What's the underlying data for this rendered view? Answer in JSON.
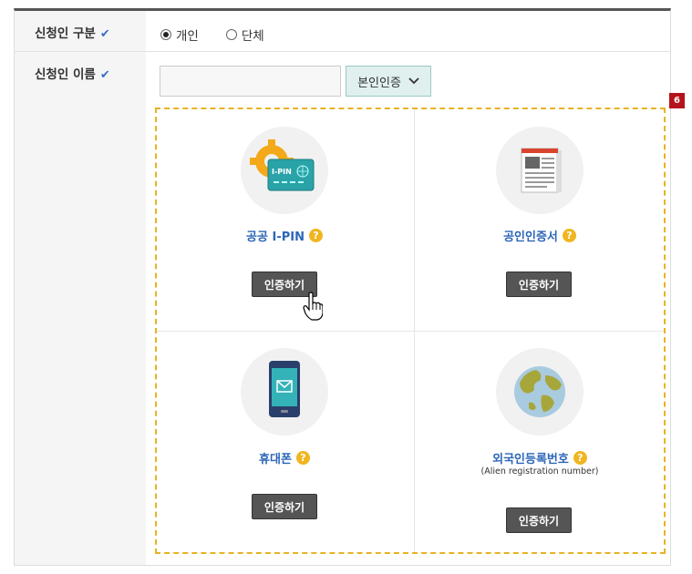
{
  "form": {
    "row1_label": "신청인 구분",
    "row2_label": "신청인 이름",
    "check_mark": "✔",
    "applicant_type": {
      "options": [
        {
          "label": "개인",
          "selected": true
        },
        {
          "label": "단체",
          "selected": false
        }
      ]
    },
    "name_input": {
      "value": "",
      "placeholder": ""
    },
    "auth_select": {
      "label": "본인인증",
      "chevron": "chevron-down-icon"
    }
  },
  "step_badge": "6",
  "auth_methods": [
    {
      "title": "공공 I-PIN",
      "icon": "ipin-card-icon",
      "button": "인증하기",
      "help": "?"
    },
    {
      "title": "공인인증서",
      "icon": "certificate-document-icon",
      "button": "인증하기",
      "help": "?"
    },
    {
      "title": "휴대폰",
      "icon": "mobile-phone-icon",
      "button": "인증하기",
      "help": "?"
    },
    {
      "title": "외국인등록번호",
      "subtitle": "(Alien registration number)",
      "icon": "globe-icon",
      "button": "인증하기",
      "help": "?"
    }
  ],
  "ipin_text": "I-PIN",
  "colors": {
    "accent_blue": "#2c66b8",
    "help_yellow": "#f0b520",
    "dashed_border": "#e8b323",
    "badge_red": "#b5131b",
    "button_dark": "#555555"
  }
}
